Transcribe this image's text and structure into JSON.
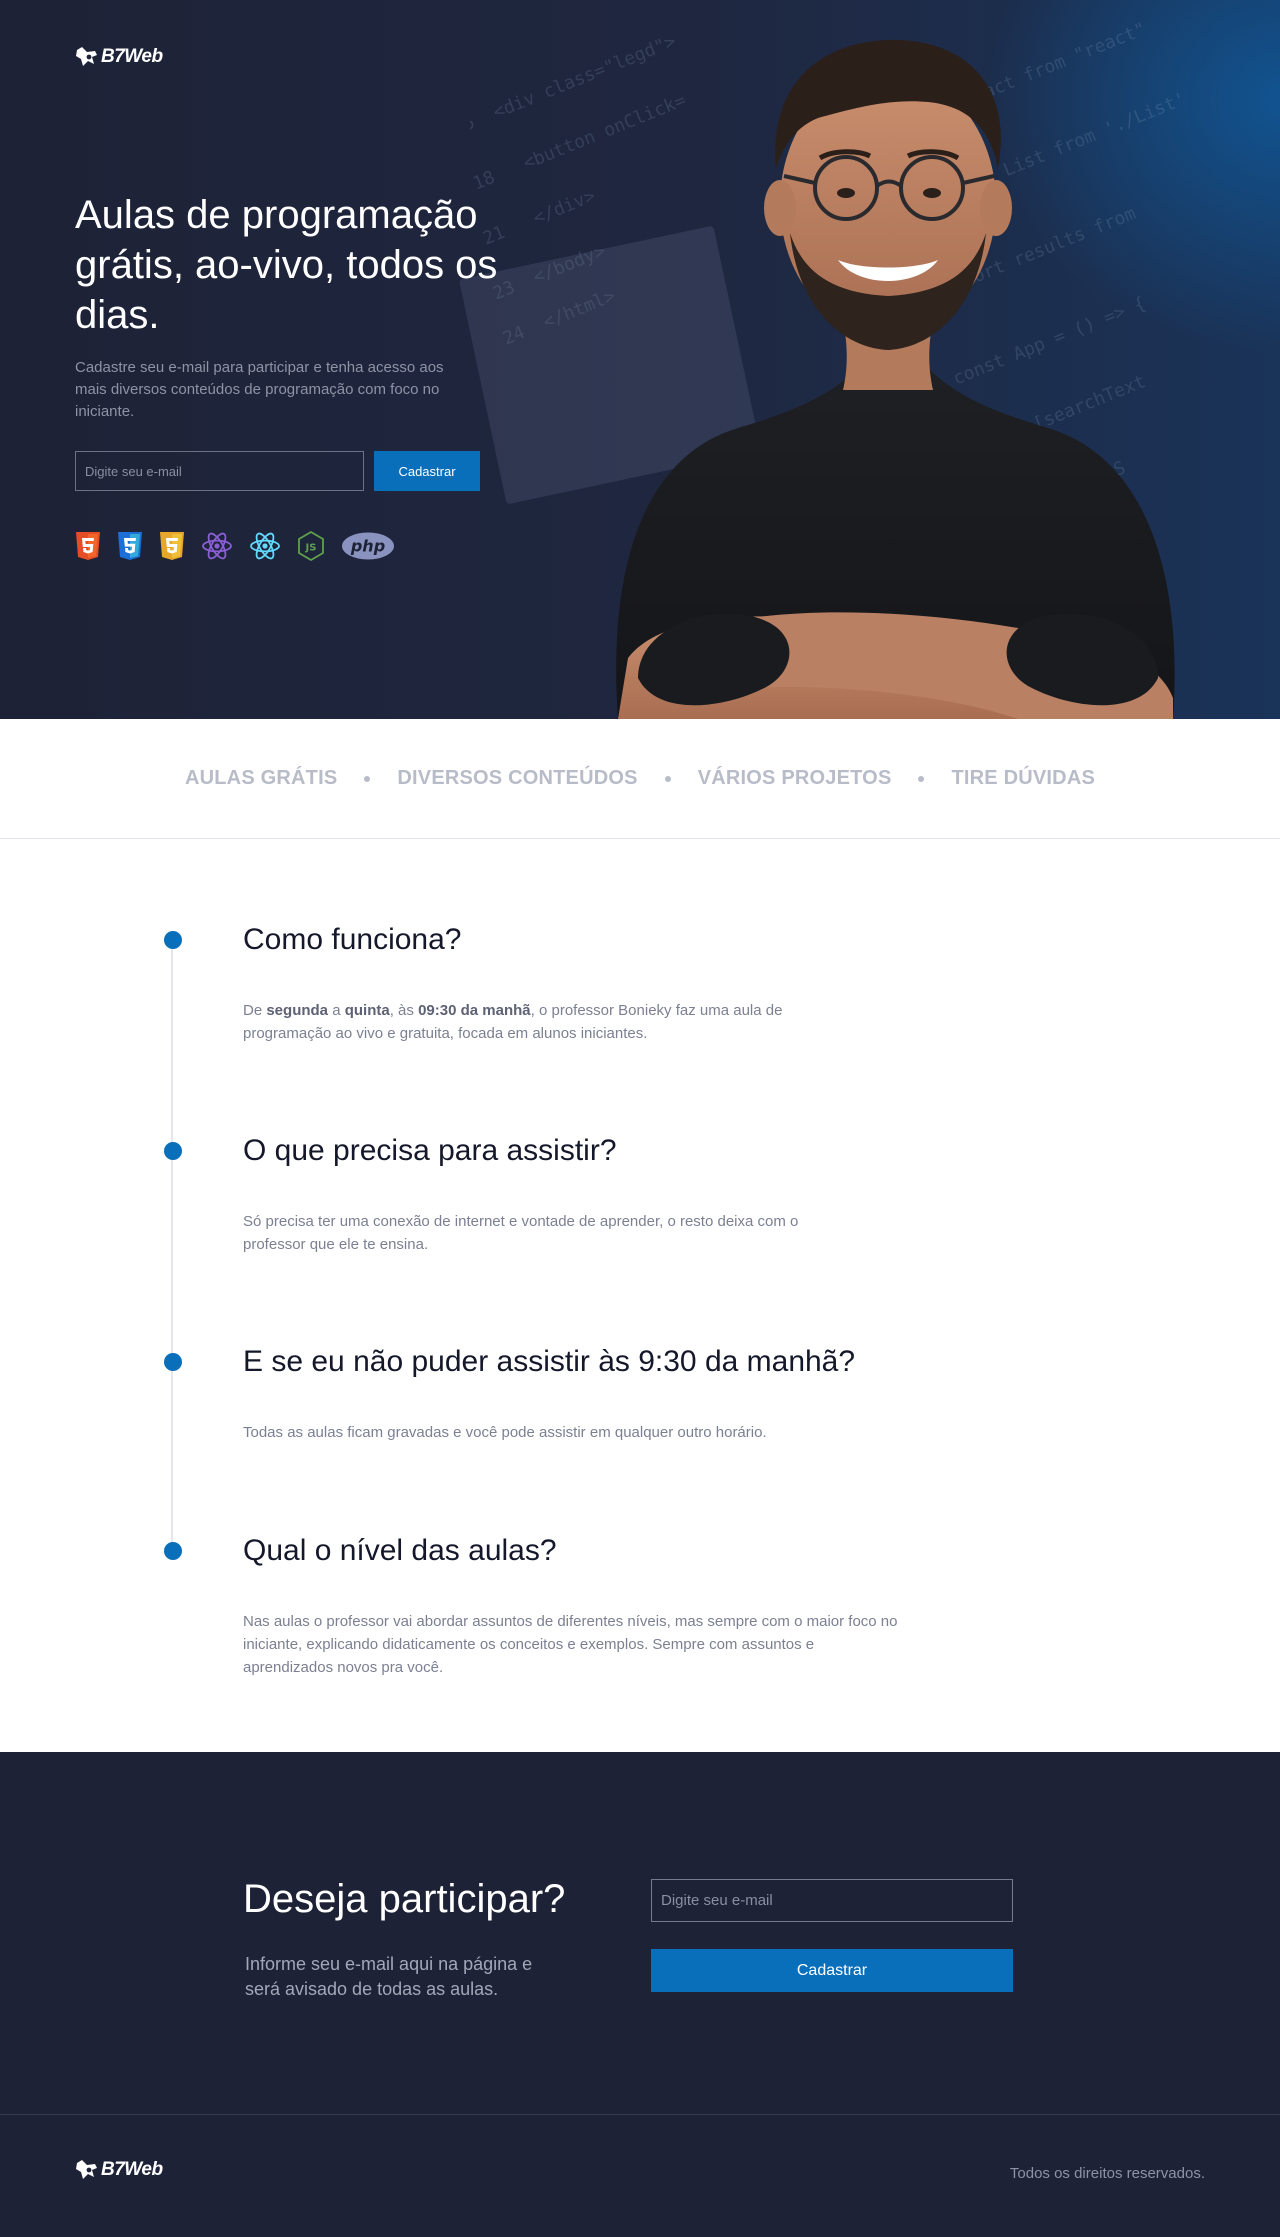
{
  "brand": {
    "name": "B7Web"
  },
  "hero": {
    "title": "Aulas de programação grátis, ao-vivo, todos os dias.",
    "subtitle": "Cadastre seu e-mail para participar e tenha acesso aos mais diversos conteúdos de programação com foco no iniciante.",
    "email_placeholder": "Digite seu e-mail",
    "submit_label": "Cadastrar",
    "tech_icons": [
      "html5-icon",
      "css3-icon",
      "javascript-shield-icon",
      "redux-icon",
      "react-icon",
      "nodejs-icon",
      "php-icon"
    ],
    "php_label": "php"
  },
  "features": [
    "AULAS GRÁTIS",
    "DIVERSOS CONTEÚDOS",
    "VÁRIOS PROJETOS",
    "TIRE DÚVIDAS"
  ],
  "faq": [
    {
      "question": "Como funciona?",
      "answer_parts": [
        "De ",
        "segunda",
        " a ",
        "quinta",
        ", às ",
        "09:30 da manhã",
        ", o professor Bonieky faz uma aula de programação ao vivo e gratuita, focada em alunos iniciantes."
      ]
    },
    {
      "question": "O que precisa para assistir?",
      "answer": "Só precisa ter uma conexão de internet e vontade de aprender, o resto deixa com o professor que ele te ensina."
    },
    {
      "question": "E se eu não puder assistir às 9:30 da manhã?",
      "answer": "Todas as aulas ficam gravadas e você pode assistir em qualquer outro horário."
    },
    {
      "question": "Qual o nível das aulas?",
      "answer": "Nas aulas o professor vai abordar assuntos de diferentes níveis, mas sempre com o maior foco no iniciante, explicando didaticamente os conceitos e exemplos. Sempre com assuntos e aprendizados novos pra você."
    }
  ],
  "cta": {
    "title": "Deseja participar?",
    "subtitle": "Informe seu e-mail aqui na página e será avisado de todas as aulas.",
    "email_placeholder": "Digite seu e-mail",
    "submit_label": "Cadastrar"
  },
  "footer": {
    "copyright": "Todos os direitos reservados."
  },
  "colors": {
    "navy": "#1d2236",
    "accent": "#0a6fba",
    "muted": "#b8bcc8"
  }
}
